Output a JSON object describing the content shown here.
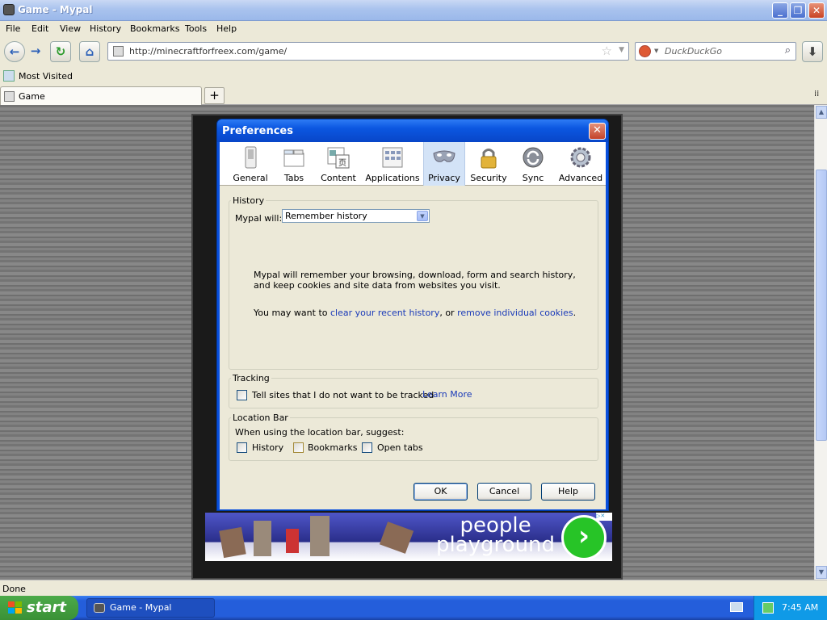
{
  "window": {
    "title": "Game - Mypal"
  },
  "menu": [
    "File",
    "Edit",
    "View",
    "History",
    "Bookmarks",
    "Tools",
    "Help"
  ],
  "nav": {
    "url": "http://minecraftforfreex.com/game/",
    "search_placeholder": "DuckDuckGo"
  },
  "bookmarks": {
    "most_visited": "Most Visited"
  },
  "tab": {
    "label": "Game",
    "new_tab_symbol": "+"
  },
  "ad": {
    "text_line1": "people",
    "text_line2": "playground"
  },
  "status": {
    "text": "Done"
  },
  "taskbar": {
    "start": "start",
    "item": "Game - Mypal",
    "clock": "7:45 AM"
  },
  "dialog": {
    "title": "Preferences",
    "tabs": [
      "General",
      "Tabs",
      "Content",
      "Applications",
      "Privacy",
      "Security",
      "Sync",
      "Advanced"
    ],
    "selected_tab": "Privacy",
    "history": {
      "legend": "History",
      "label": "Mypal will:",
      "selected": "Remember history",
      "desc": "Mypal will remember your browsing, download, form and search history, and keep cookies and site data from websites you visit.",
      "may_want": "You may want to",
      "link1": "clear your recent history",
      "or": ", or",
      "link2": "remove individual cookies",
      "period": "."
    },
    "tracking": {
      "legend": "Tracking",
      "checkbox": "Tell sites that I do not want to be tracked",
      "checked": false,
      "learn_more": "Learn More"
    },
    "location_bar": {
      "legend": "Location Bar",
      "label": "When using the location bar, suggest:",
      "options": [
        {
          "label": "History",
          "checked": false
        },
        {
          "label": "Bookmarks",
          "checked": false
        },
        {
          "label": "Open tabs",
          "checked": false
        }
      ]
    },
    "buttons": {
      "ok": "OK",
      "cancel": "Cancel",
      "help": "Help"
    }
  }
}
